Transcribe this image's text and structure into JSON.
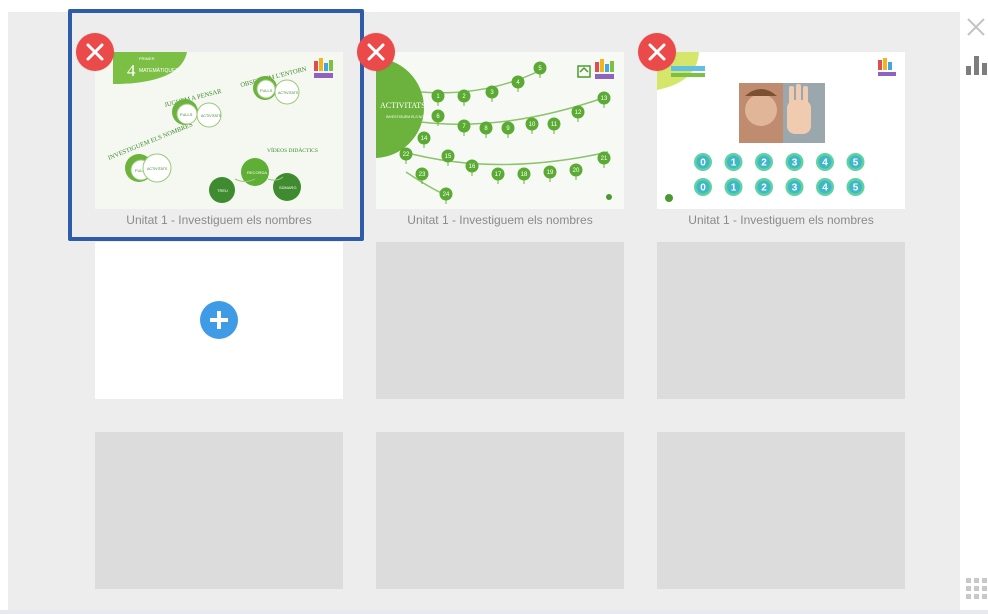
{
  "cards": [
    {
      "caption": "Unitat 1 - Investiguem els nombres",
      "thumb": {
        "badge": "4",
        "badge_sub": "PRIMER",
        "heading": "MATEMÀTIQUES",
        "label_pensar": "JUGUEM A PENSAR",
        "label_entorn": "OBSERVEM L'ENTORN",
        "label_nombres": "INVESTIGUEM ELS NOMBRES",
        "label_videos": "VÍDEOS DIDÀCTICS",
        "pill_fulls_1": "FULLS",
        "pill_activitats_1": "ACTIVITATS",
        "pill_fulls_2": "FULLS",
        "pill_activitats_2": "ACTIVITATS",
        "pill_fulls_3": "FULLS",
        "pill_activitats_3": "ACTIVITATS",
        "pill_recorda": "RECORDA",
        "pill_treu": "TREU",
        "pill_sumarg": "SÚMARG"
      }
    },
    {
      "caption": "Unitat 1 - Investiguem els nombres",
      "thumb": {
        "title": "ACTIVITATS",
        "subtitle": "INVESTIGUEM ELS NOMBRES",
        "nodes": [
          "1",
          "2",
          "3",
          "4",
          "5",
          "6",
          "7",
          "8",
          "9",
          "10",
          "11",
          "12",
          "13",
          "14",
          "15",
          "16",
          "17",
          "18",
          "19",
          "20",
          "21",
          "22",
          "23",
          "24"
        ]
      }
    },
    {
      "caption": "Unitat 1 - Investiguem els nombres",
      "thumb": {
        "row1": [
          "0",
          "1",
          "2",
          "3",
          "4",
          "5"
        ],
        "row2": [
          "0",
          "1",
          "2",
          "3",
          "4",
          "5"
        ]
      }
    }
  ],
  "colors": {
    "selection": "#2f5ca8",
    "delete": "#ea4a4a",
    "add": "#3f9be6",
    "green_dark": "#3f8b2f",
    "green_light": "#7cc242",
    "teal": "#4fcf9d"
  },
  "icons": [
    "close-icon",
    "bar-chart-icon",
    "grid-icon",
    "plus-icon",
    "delete-icon"
  ]
}
